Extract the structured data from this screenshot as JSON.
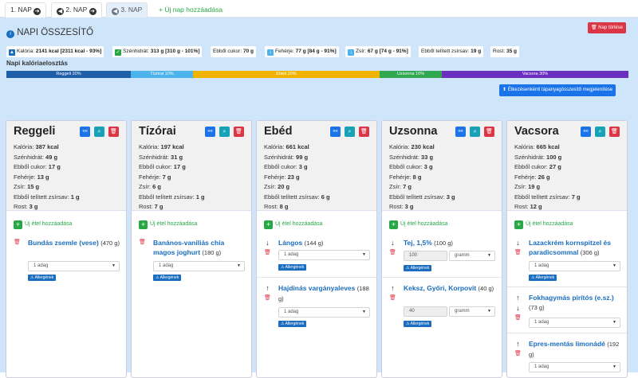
{
  "tabs": [
    {
      "label": "1. NAP",
      "active": false
    },
    {
      "label": "2. NAP",
      "active": false
    },
    {
      "label": "3. NAP",
      "active": true
    }
  ],
  "add_day_label": "+ Új nap hozzáadása",
  "page_title": "NAPI ÖSSZESÍTŐ",
  "delete_day_label": "Nap törlése",
  "summary": {
    "kaloria": {
      "label": "Kalória:",
      "value": "2141 kcal [2311 kcal - 93%]"
    },
    "szenhidrat": {
      "label": "Szénhidrát:",
      "value": "313 g [310 g - 101%]"
    },
    "cukor": {
      "label": "Ebből cukor:",
      "value": "70 g"
    },
    "feherje": {
      "label": "Fehérje:",
      "value": "77 g [84 g - 91%]"
    },
    "zsir": {
      "label": "Zsír:",
      "value": "67 g [74 g - 91%]"
    },
    "telitett": {
      "label": "Ebből telített zsírsav:",
      "value": "19 g"
    },
    "rost": {
      "label": "Rost:",
      "value": "35 g"
    }
  },
  "calorie_distribution_title": "Napi kalóriaelosztás",
  "calorie_distribution": [
    {
      "label": "Reggeli 20%",
      "percent": 20,
      "color": "#1f5ea8"
    },
    {
      "label": "Tízórai 10%",
      "percent": 10,
      "color": "#4db3ec"
    },
    {
      "label": "Ebéd 30%",
      "percent": 30,
      "color": "#f0b400"
    },
    {
      "label": "Uzsonna 10%",
      "percent": 10,
      "color": "#2fa84f"
    },
    {
      "label": "Vacsora 30%",
      "percent": 30,
      "color": "#6a2fbf"
    }
  ],
  "show_breakdown_label": "Étkezésenkénti tápanyagösszesítő megjelenítése",
  "nutrient_labels": {
    "kaloria": "Kalória:",
    "szenhidrat": "Szénhidrát:",
    "cukor": "Ebből cukor:",
    "feherje": "Fehérje:",
    "zsir": "Zsír:",
    "telitett": "Ebből telített zsírsav:",
    "rost": "Rost:"
  },
  "add_food_label": "Új étel hozzáadása",
  "allergen_label": "Allergének",
  "meals": [
    {
      "title": "Reggeli",
      "nutrients": {
        "kaloria": "387 kcal",
        "szenhidrat": "49 g",
        "cukor": "17 g",
        "feherje": "13 g",
        "zsir": "15 g",
        "telitett": "1 g",
        "rost": "3 g"
      },
      "foods": [
        {
          "name": "Bundás zsemle (vese)",
          "amount": "(470 g)",
          "select": "1 adag",
          "input": null,
          "unit": null
        }
      ]
    },
    {
      "title": "Tízórai",
      "nutrients": {
        "kaloria": "197 kcal",
        "szenhidrat": "31 g",
        "cukor": "17 g",
        "feherje": "7 g",
        "zsir": "6 g",
        "telitett": "1 g",
        "rost": "7 g"
      },
      "foods": [
        {
          "name": "Banános-vaníliás chia magos joghurt",
          "amount": "(180 g)",
          "select": "1 adag",
          "input": null,
          "unit": null
        }
      ]
    },
    {
      "title": "Ebéd",
      "nutrients": {
        "kaloria": "661 kcal",
        "szenhidrat": "99 g",
        "cukor": "3 g",
        "feherje": "23 g",
        "zsir": "20 g",
        "telitett": "6 g",
        "rost": "8 g"
      },
      "foods": [
        {
          "name": "Lángos",
          "amount": "(144 g)",
          "select": "1 adag",
          "input": null,
          "unit": null
        },
        {
          "name": "Hajdinás vargányaleves",
          "amount": "(188 g)",
          "select": "1 adag",
          "input": null,
          "unit": null
        }
      ]
    },
    {
      "title": "Uzsonna",
      "nutrients": {
        "kaloria": "230 kcal",
        "szenhidrat": "33 g",
        "cukor": "3 g",
        "feherje": "8 g",
        "zsir": "7 g",
        "telitett": "3 g",
        "rost": "3 g"
      },
      "foods": [
        {
          "name": "Tej, 1,5%",
          "amount": "(100 g)",
          "select": null,
          "input": "100",
          "unit": "gramm"
        },
        {
          "name": "Keksz, Győri, Korpovit",
          "amount": "(40 g)",
          "select": null,
          "input": "40",
          "unit": "gramm"
        }
      ]
    },
    {
      "title": "Vacsora",
      "nutrients": {
        "kaloria": "665 kcal",
        "szenhidrat": "100 g",
        "cukor": "27 g",
        "feherje": "26 g",
        "zsir": "19 g",
        "telitett": "7 g",
        "rost": "12 g"
      },
      "foods": [
        {
          "name": "Lazackrém kornspitzel és paradicsommal",
          "amount": "(306 g)",
          "select": "1 adag",
          "input": null,
          "unit": null
        },
        {
          "name": "Fokhagymás pirítós (e.sz.)",
          "amount": "(73 g)",
          "select": "1 adag",
          "input": null,
          "unit": null
        },
        {
          "name": "Epres-mentás limonádé",
          "amount": "(192 g)",
          "select": "1 adag",
          "input": null,
          "unit": null
        }
      ]
    }
  ]
}
